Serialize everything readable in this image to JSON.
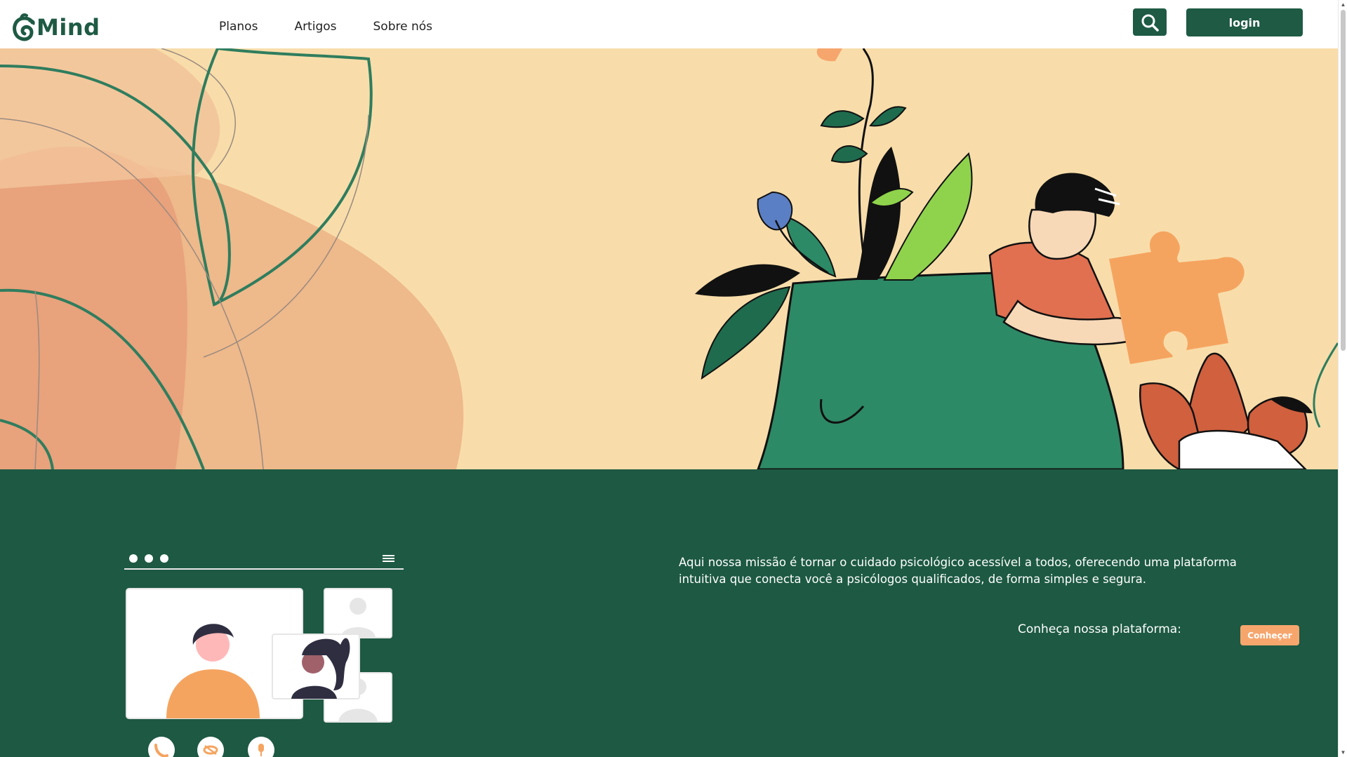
{
  "header": {
    "logo_text": "Mind",
    "nav": [
      {
        "label": "Planos"
      },
      {
        "label": "Artigos"
      },
      {
        "label": "Sobre nós"
      }
    ],
    "search_icon": "search-icon",
    "login_label": "login"
  },
  "mission": {
    "text": "Aqui nossa missão é tornar o cuidado psicológico acessível a todos, oferecendo uma plataforma intuitiva que conecta você a psicólogos qualificados, de forma simples e segura.",
    "cta_label": "Conheça nossa plataforma:",
    "cta_button": "Conheçer"
  },
  "colors": {
    "brand_green": "#1e5a44",
    "section_green": "#1d5943",
    "hero_bg": "#f8ddaa",
    "accent_orange": "#f6a66d"
  }
}
